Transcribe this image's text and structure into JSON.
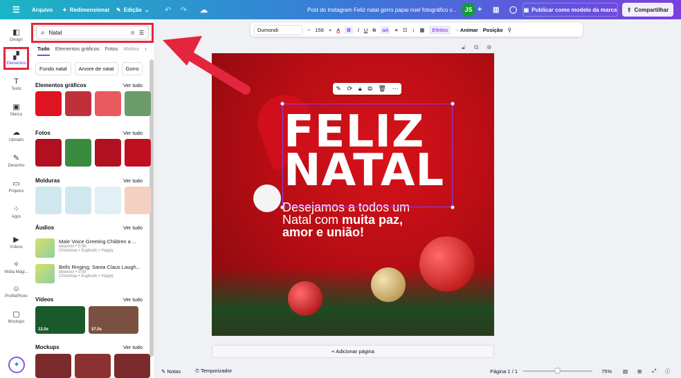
{
  "topbar": {
    "menu_icon": "hamburger-icon",
    "file": "Arquivo",
    "resize": "Redimensionar",
    "edit": "Edição",
    "doc_title": "Post do Instagram Feliz natal gorro papai noel fotográfico v...",
    "avatar": "JS",
    "publish": "Publicar como modelo da marca",
    "share": "Compartilhar"
  },
  "rail": [
    {
      "label": "Design",
      "icon": "layout-icon"
    },
    {
      "label": "Elementos",
      "icon": "shapes-icon"
    },
    {
      "label": "Texto",
      "icon": "text-icon"
    },
    {
      "label": "Marca",
      "icon": "brand-icon"
    },
    {
      "label": "Uploads",
      "icon": "upload-icon"
    },
    {
      "label": "Desenho",
      "icon": "draw-icon"
    },
    {
      "label": "Projetos",
      "icon": "folder-icon"
    },
    {
      "label": "Apps",
      "icon": "apps-icon"
    },
    {
      "label": "Vídeos",
      "icon": "video-icon"
    },
    {
      "label": "Mídia Mági...",
      "icon": "magic-media-icon"
    },
    {
      "label": "ProfilePhoto",
      "icon": "profile-photo-icon"
    },
    {
      "label": "Mockups",
      "icon": "mockups-icon"
    }
  ],
  "search": {
    "value": "Natal"
  },
  "tabs": [
    "Tudo",
    "Elementos gráficos",
    "Fotos",
    "Moldur"
  ],
  "chips": [
    "Fundo natal",
    "Arvore de natal",
    "Gorro"
  ],
  "sections": {
    "graphics": "Elementos gráficos",
    "photos": "Fotos",
    "frames": "Molduras",
    "audios": "Áudios",
    "videos": "Vídeos",
    "mockups": "Mockups",
    "see_all": "Ver tudo"
  },
  "audios": [
    {
      "title": "Male Voice Greeting Children a ...",
      "meta": "ebavoxx • 0:06",
      "tags": "Christmas • Euphoric • Happy"
    },
    {
      "title": "Bells Ringing, Santa Claus Laugh...",
      "meta": "ebavoxx • 0:09",
      "tags": "Christmas • Euphoric • Happy"
    }
  ],
  "videos": [
    "12.0s",
    "37.0s"
  ],
  "toolbar": {
    "font": "Dumondi",
    "size": "156",
    "bold": "B",
    "italic": "I",
    "underline": "U",
    "strike": "S",
    "case": "aA",
    "effects": "Efeitos",
    "animate": "Animar",
    "position": "Posição"
  },
  "canvas": {
    "title1": "FELIZ",
    "title2": "NATAL",
    "line1": "Desejamos a todos um",
    "line2a": "Natal com ",
    "line2b": "muita paz,",
    "line3": "amor e união!"
  },
  "add_page": "+ Adicionar página",
  "bottom": {
    "notes": "Notas",
    "timer": "Temporizador",
    "page": "Página 1 / 1",
    "zoom": "75%",
    "zoom_value": 75
  },
  "colors": {
    "accent": "#8b3dff",
    "highlight": "#e3263d",
    "canvas_bg": "#c0101a"
  }
}
